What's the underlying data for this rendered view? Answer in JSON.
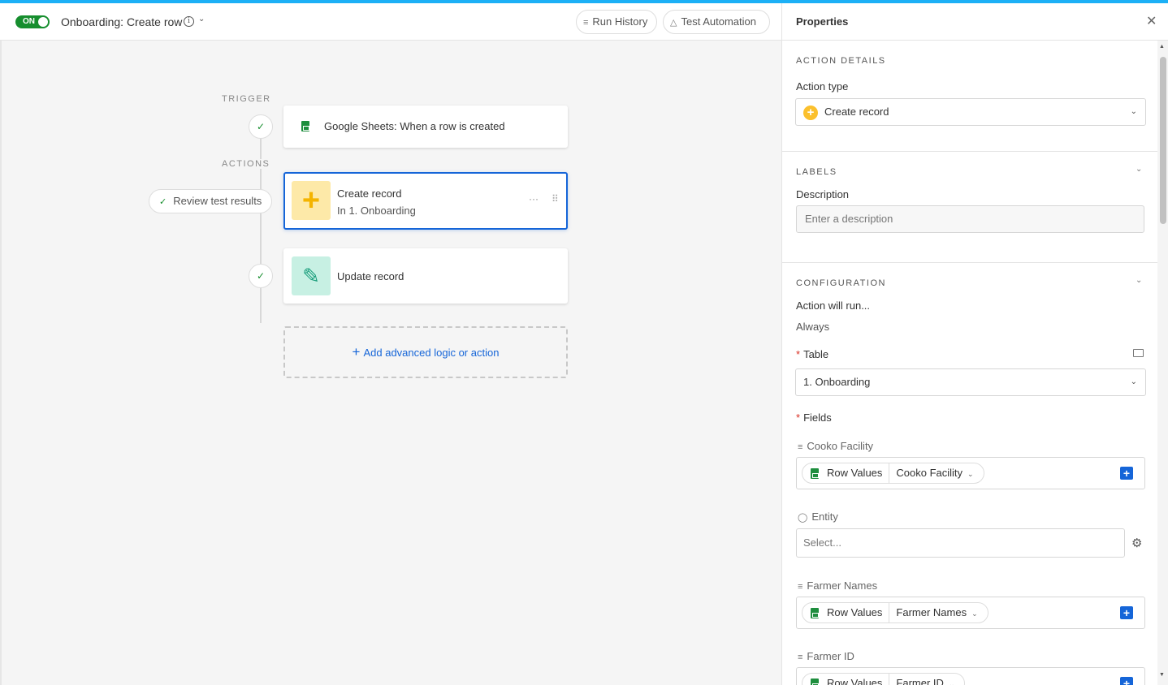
{
  "header": {
    "toggle_label": "ON",
    "automation_title": "Onboarding: Create row",
    "run_history_label": "Run History",
    "test_automation_label": "Test Automation"
  },
  "canvas": {
    "trigger_label": "TRIGGER",
    "actions_label": "ACTIONS",
    "review_label": "Review test results",
    "trigger_card": {
      "title": "Google Sheets: When a row is created"
    },
    "create_card": {
      "title": "Create record",
      "subtitle": "In 1. Onboarding",
      "more": "···",
      "handle": "⠿"
    },
    "update_card": {
      "title": "Update record"
    },
    "add_label": "Add advanced logic or action"
  },
  "panel": {
    "title": "Properties",
    "action_details": {
      "section": "ACTION DETAILS",
      "action_type_label": "Action type",
      "action_type_value": "Create record"
    },
    "labels": {
      "section": "LABELS",
      "description_label": "Description",
      "description_placeholder": "Enter a description"
    },
    "configuration": {
      "section": "CONFIGURATION",
      "run_label": "Action will run...",
      "run_value": "Always",
      "table_label": "Table",
      "table_value": "1. Onboarding",
      "fields_label": "Fields",
      "fields": [
        {
          "name": "Cooko Facility",
          "source": "Row Values",
          "column": "Cooko Facility"
        },
        {
          "name": "Entity",
          "placeholder": "Select..."
        },
        {
          "name": "Farmer Names",
          "source": "Row Values",
          "column": "Farmer Names"
        },
        {
          "name": "Farmer ID",
          "source": "Row Values",
          "column": "Farmer ID"
        }
      ]
    }
  },
  "colors": {
    "accent": "#1565d8",
    "toggle_on": "#168e2e",
    "create_tile": "#fde9a8",
    "update_tile": "#c7f0e3",
    "top_stripe": "#1cb0f6"
  }
}
